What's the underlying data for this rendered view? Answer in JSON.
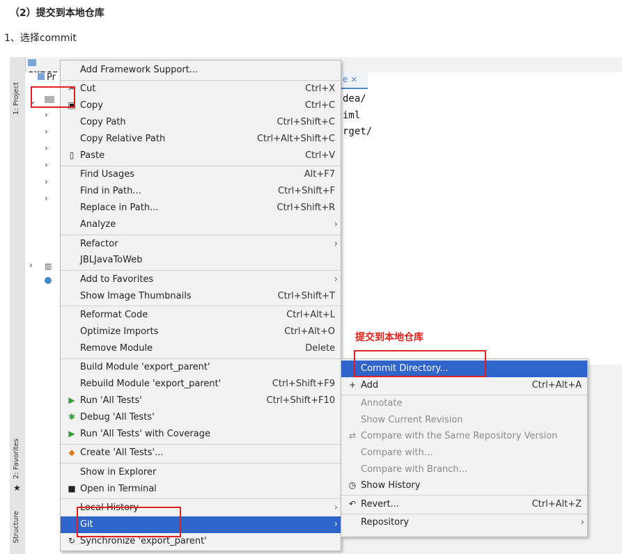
{
  "doc": {
    "heading": "（2）提交到本地仓库",
    "step": "1、选择commit"
  },
  "ide": {
    "project_title": "expor",
    "tree_prefix": "Pr",
    "left_tabs": [
      "1: Project",
      "2: Favorites",
      "Structure"
    ],
    "editor_tab": "e ×",
    "editor_lines": [
      "dea/",
      "iml",
      "rget/"
    ]
  },
  "context_menu": [
    {
      "label": "Add Framework Support...",
      "shortcut": "",
      "icon": "",
      "arrow": false
    },
    {
      "sep": true
    },
    {
      "label": "Cut",
      "shortcut": "Ctrl+X",
      "icon": "scissors-icon",
      "arrow": false
    },
    {
      "label": "Copy",
      "shortcut": "Ctrl+C",
      "icon": "copy-icon",
      "arrow": false
    },
    {
      "label": "Copy Path",
      "shortcut": "Ctrl+Shift+C",
      "icon": "",
      "arrow": false
    },
    {
      "label": "Copy Relative Path",
      "shortcut": "Ctrl+Alt+Shift+C",
      "icon": "",
      "arrow": false
    },
    {
      "label": "Paste",
      "shortcut": "Ctrl+V",
      "icon": "paste-icon",
      "arrow": false
    },
    {
      "sep": true
    },
    {
      "label": "Find Usages",
      "shortcut": "Alt+F7",
      "icon": "",
      "arrow": false
    },
    {
      "label": "Find in Path...",
      "shortcut": "Ctrl+Shift+F",
      "icon": "",
      "arrow": false
    },
    {
      "label": "Replace in Path...",
      "shortcut": "Ctrl+Shift+R",
      "icon": "",
      "arrow": false
    },
    {
      "label": "Analyze",
      "shortcut": "",
      "icon": "",
      "arrow": true
    },
    {
      "sep": true
    },
    {
      "label": "Refactor",
      "shortcut": "",
      "icon": "",
      "arrow": true
    },
    {
      "label": "JBLJavaToWeb",
      "shortcut": "",
      "icon": "",
      "arrow": false
    },
    {
      "sep": true
    },
    {
      "label": "Add to Favorites",
      "shortcut": "",
      "icon": "",
      "arrow": true
    },
    {
      "label": "Show Image Thumbnails",
      "shortcut": "Ctrl+Shift+T",
      "icon": "",
      "arrow": false
    },
    {
      "sep": true
    },
    {
      "label": "Reformat Code",
      "shortcut": "Ctrl+Alt+L",
      "icon": "",
      "arrow": false
    },
    {
      "label": "Optimize Imports",
      "shortcut": "Ctrl+Alt+O",
      "icon": "",
      "arrow": false
    },
    {
      "label": "Remove Module",
      "shortcut": "Delete",
      "icon": "",
      "arrow": false
    },
    {
      "sep": true
    },
    {
      "label": "Build Module 'export_parent'",
      "shortcut": "",
      "icon": "",
      "arrow": false
    },
    {
      "label": "Rebuild Module 'export_parent'",
      "shortcut": "Ctrl+Shift+F9",
      "icon": "",
      "arrow": false
    },
    {
      "label": "Run 'All Tests'",
      "shortcut": "Ctrl+Shift+F10",
      "icon": "run-icon",
      "arrow": false
    },
    {
      "label": "Debug 'All Tests'",
      "shortcut": "",
      "icon": "debug-icon",
      "arrow": false
    },
    {
      "label": "Run 'All Tests' with Coverage",
      "shortcut": "",
      "icon": "coverage-icon",
      "arrow": false
    },
    {
      "sep": true
    },
    {
      "label": "Create 'All Tests'...",
      "shortcut": "",
      "icon": "create-test-icon",
      "arrow": false
    },
    {
      "sep": true
    },
    {
      "label": "Show in Explorer",
      "shortcut": "",
      "icon": "",
      "arrow": false
    },
    {
      "label": "Open in Terminal",
      "shortcut": "",
      "icon": "terminal-icon",
      "arrow": false
    },
    {
      "sep": true
    },
    {
      "label": "Local History",
      "shortcut": "",
      "icon": "",
      "arrow": true
    },
    {
      "label": "Git",
      "shortcut": "",
      "icon": "",
      "arrow": true,
      "selected": true
    },
    {
      "label": "Synchronize 'export_parent'",
      "shortcut": "",
      "icon": "sync-icon",
      "arrow": false
    }
  ],
  "git_menu": [
    {
      "label": "Commit Directory...",
      "shortcut": "",
      "icon": "",
      "selected": true
    },
    {
      "label": "Add",
      "shortcut": "Ctrl+Alt+A",
      "icon": "plus-icon"
    },
    {
      "sep": true
    },
    {
      "label": "Annotate",
      "shortcut": "",
      "icon": "",
      "disabled": true
    },
    {
      "label": "Show Current Revision",
      "shortcut": "",
      "icon": "",
      "disabled": true
    },
    {
      "label": "Compare with the Same Repository Version",
      "shortcut": "",
      "icon": "compare-icon",
      "disabled": true
    },
    {
      "label": "Compare with...",
      "shortcut": "",
      "icon": "",
      "disabled": true
    },
    {
      "label": "Compare with Branch...",
      "shortcut": "",
      "icon": "",
      "disabled": true
    },
    {
      "label": "Show History",
      "shortcut": "",
      "icon": "history-icon"
    },
    {
      "sep": true
    },
    {
      "label": "Revert...",
      "shortcut": "Ctrl+Alt+Z",
      "icon": "revert-icon"
    },
    {
      "sep": true
    },
    {
      "label": "Repository",
      "shortcut": "",
      "icon": "",
      "arrow": true
    }
  ],
  "annotation": "提交到本地仓库",
  "colors": {
    "selection": "#2f65ca",
    "annotation": "#e0201a"
  }
}
